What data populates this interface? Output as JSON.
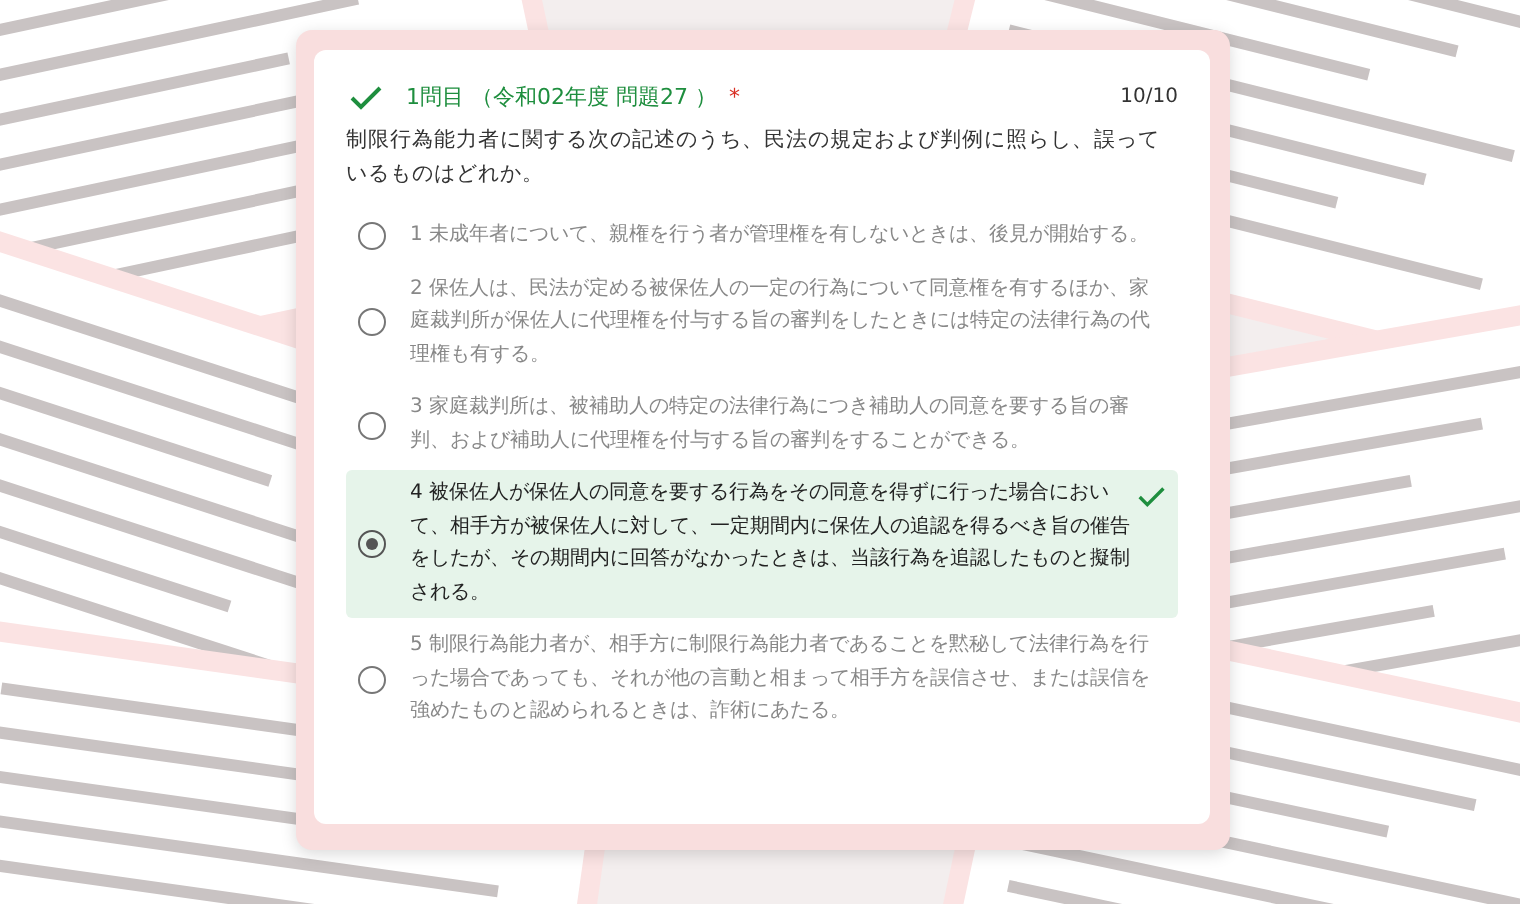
{
  "question": {
    "title": "1問目 （令和02年度 問題27 ）",
    "required_mark": "*",
    "score": "10/10",
    "correct": true,
    "prompt": "制限行為能力者に関する次の記述のうち、民法の規定および判例に照らし、誤っているものはどれか。"
  },
  "options": [
    {
      "text": "1 未成年者について、親権を行う者が管理権を有しないときは、後見が開始する。",
      "selected": false,
      "correct": false
    },
    {
      "text": "2 保佐人は、民法が定める被保佐人の一定の行為について同意権を有するほか、家庭裁判所が保佐人に代理権を付与する旨の審判をしたときには特定の法律行為の代理権も有する。",
      "selected": false,
      "correct": false
    },
    {
      "text": "3 家庭裁判所は、被補助人の特定の法律行為につき補助人の同意を要する旨の審判、および補助人に代理権を付与する旨の審判をすることができる。",
      "selected": false,
      "correct": false
    },
    {
      "text": "4 被保佐人が保佐人の同意を要する行為をその同意を得ずに行った場合において、相手方が被保佐人に対して、一定期間内に保佐人の追認を得るべき旨の催告をしたが、その期間内に回答がなかったときは、当該行為を追認したものと擬制される。",
      "selected": true,
      "correct": true
    },
    {
      "text": "5 制限行為能力者が、相手方に制限行為能力者であることを黙秘して法律行為を行った場合であっても、それが他の言動と相まって相手方を誤信させ、または誤信を強めたものと認められるときは、詐術にあたる。",
      "selected": false,
      "correct": false
    }
  ]
}
